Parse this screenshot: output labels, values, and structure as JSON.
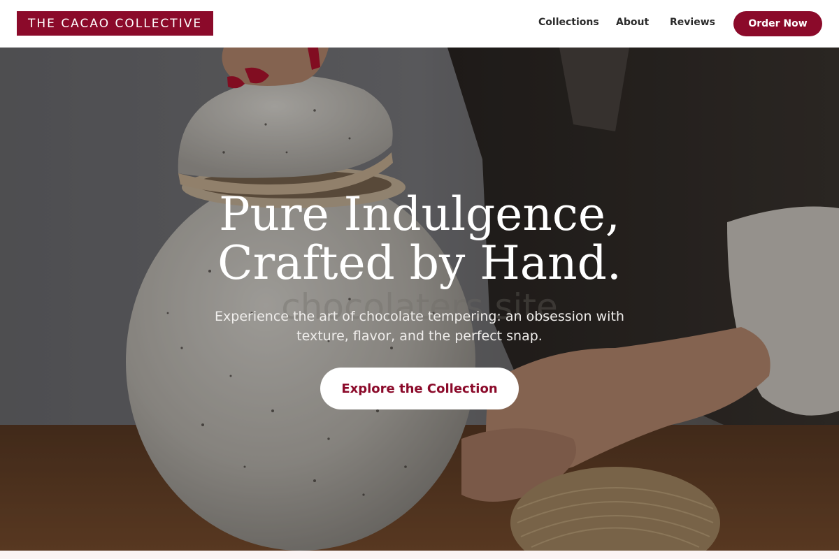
{
  "header": {
    "brand": "THE CACAO COLLECTIVE",
    "nav": [
      {
        "label": "Collections"
      },
      {
        "label": "About"
      },
      {
        "label": "Reviews"
      }
    ],
    "cta_label": "Order Now"
  },
  "hero": {
    "headline_line1": "Pure Indulgence,",
    "headline_line2": "Crafted by Hand.",
    "subtext_line1": "Experience the art of chocolate tempering: an obsession with",
    "subtext_line2": "texture, flavor, and the perfect snap.",
    "cta_label": "Explore the Collection",
    "watermark": "chocolaters site"
  },
  "colors": {
    "brand": "#8b0a2a",
    "nav_text": "#2b2b2b",
    "hero_text": "#ffffff",
    "bottom_strip": "#fbf4f4"
  },
  "icons": {
    "hero_image": "ceramic-jar-photo"
  }
}
